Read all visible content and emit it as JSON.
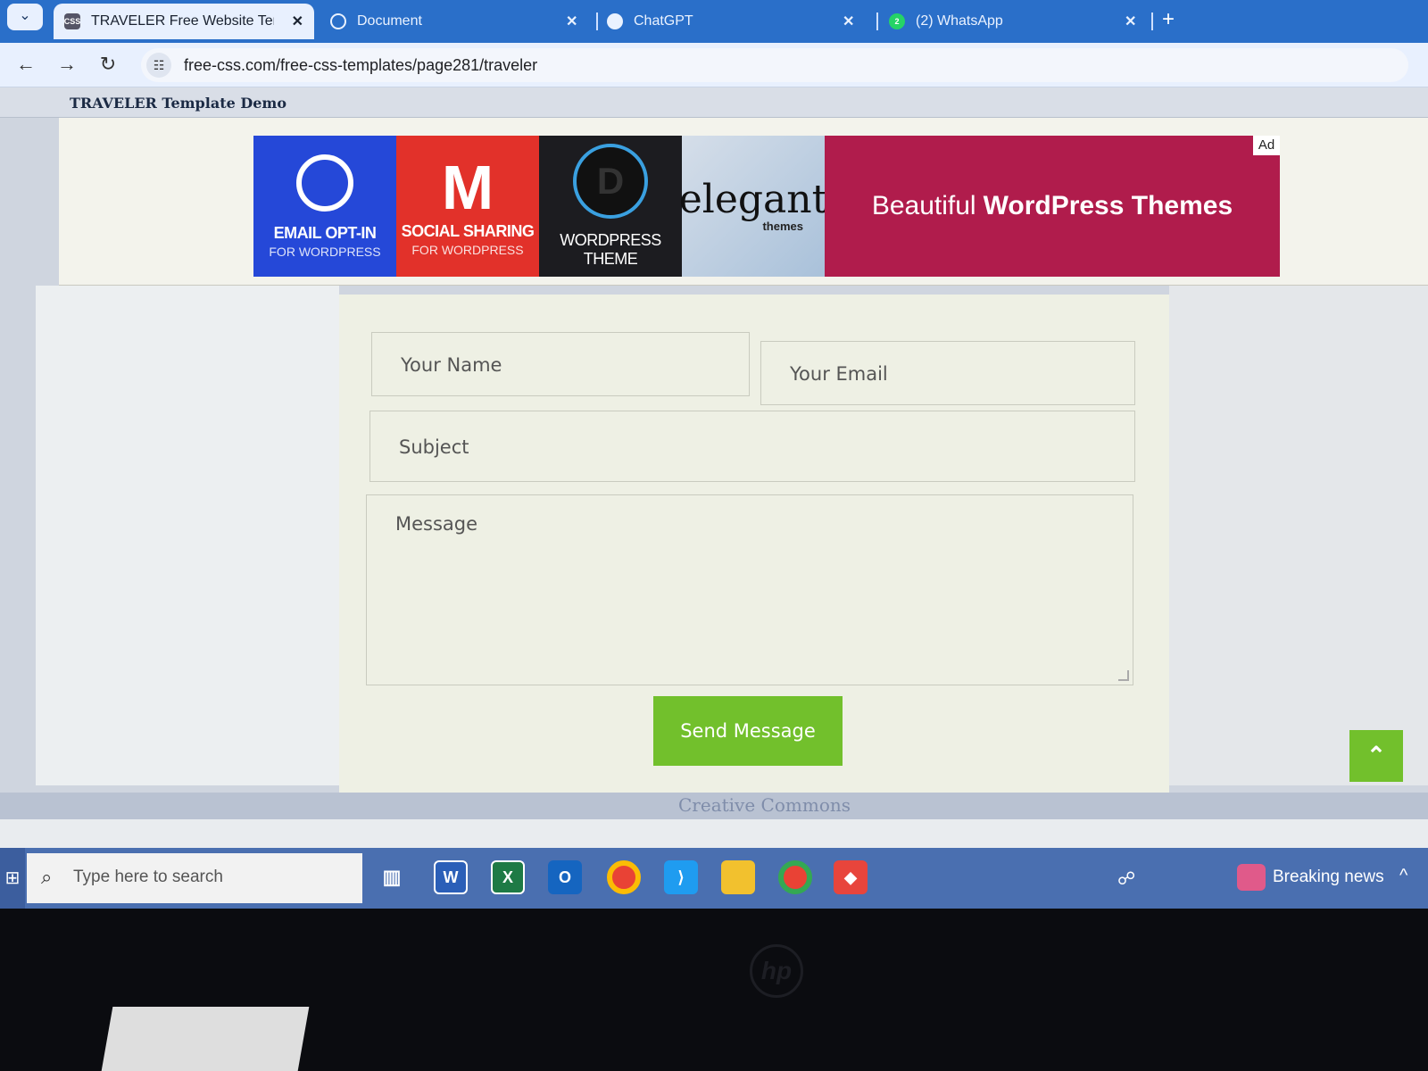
{
  "browser": {
    "tabs": [
      {
        "title": "TRAVELER Free Website Templa",
        "favicon": "CSS",
        "active": true
      },
      {
        "title": "Document",
        "favicon": "globe-icon",
        "active": false
      },
      {
        "title": "ChatGPT",
        "favicon": "chatgpt-icon",
        "active": false
      },
      {
        "title": "(2) WhatsApp",
        "favicon": "whatsapp-icon",
        "active": false
      }
    ],
    "close_glyph": "✕",
    "new_tab_glyph": "+",
    "url": "free-css.com/free-css-templates/page281/traveler"
  },
  "page": {
    "demo_title": "TRAVELER Template Demo",
    "ad": {
      "label": "Ad",
      "tiles": [
        {
          "line1": "EMAIL OPT-IN",
          "line2": "FOR WORDPRESS"
        },
        {
          "line1": "SOCIAL SHARING",
          "line2": "FOR WORDPRESS"
        },
        {
          "line1": "WORDPRESS THEME",
          "line2": ""
        },
        {
          "line1": "elegant",
          "line2": "themes"
        }
      ],
      "headline_lead": "Beautiful",
      "headline_strong": "WordPress Themes"
    },
    "form": {
      "name_placeholder": "Your Name",
      "email_placeholder": "Your Email",
      "subject_placeholder": "Subject",
      "message_placeholder": "Message",
      "send_label": "Send Message"
    },
    "back_to_top_glyph": "⌃",
    "footer_text": "Creative Commons"
  },
  "taskbar": {
    "search_placeholder": "Type here to search",
    "apps": [
      "task-view",
      "word",
      "excel",
      "outlook",
      "chrome",
      "vscode",
      "file-explorer",
      "chrome-profile",
      "anydesk"
    ],
    "news_label": "Breaking news"
  },
  "colors": {
    "accent_green": "#72c02c",
    "tab_bar_blue": "#2a6fc9",
    "ad_crimson": "#b01c4c"
  }
}
